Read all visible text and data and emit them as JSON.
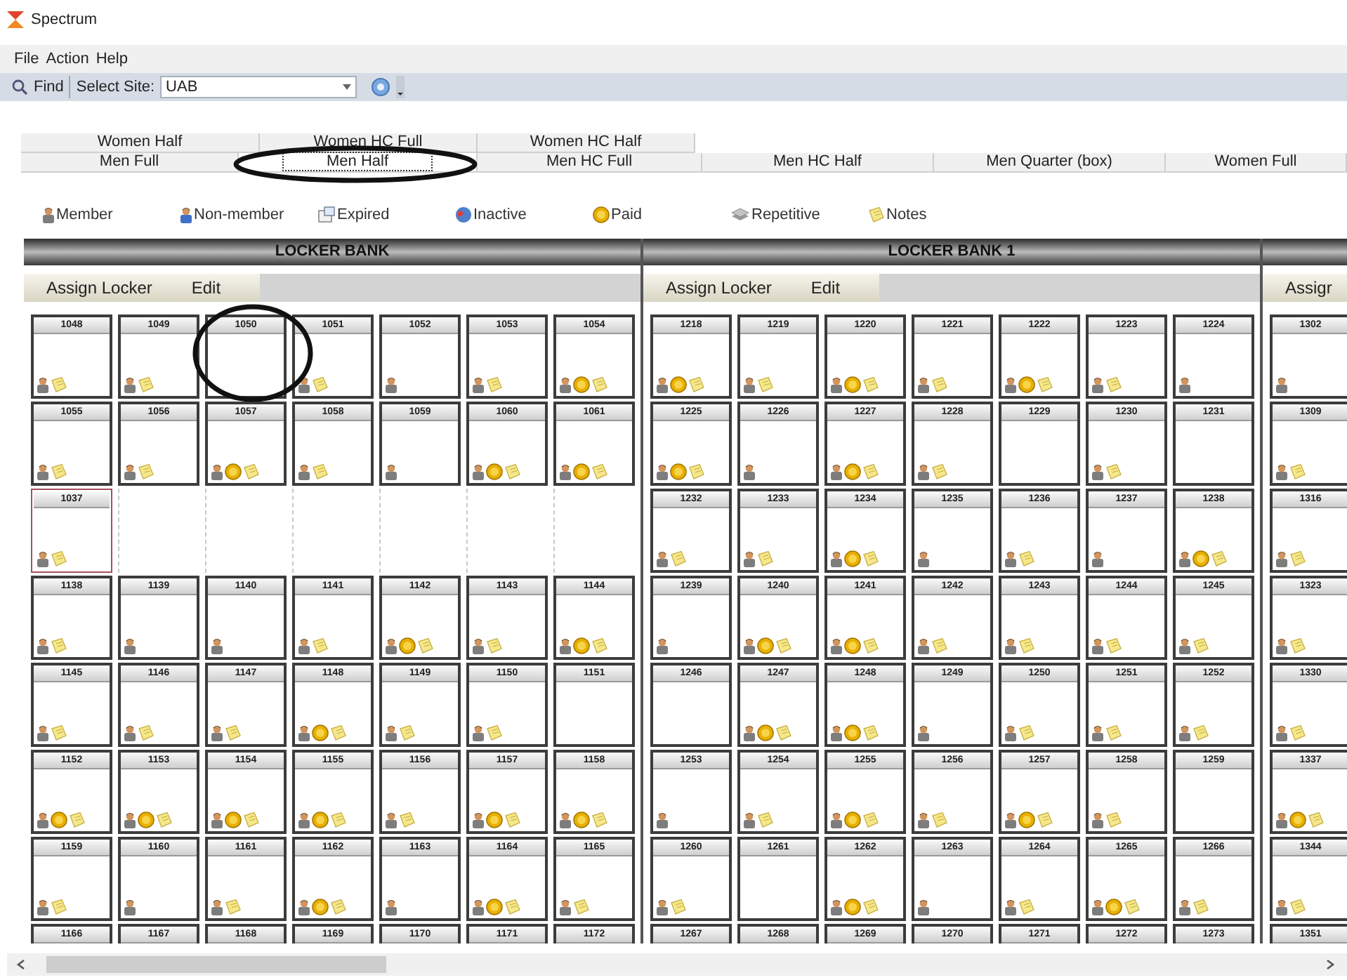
{
  "window": {
    "title": "Spectrum"
  },
  "menu": [
    "File",
    "Action",
    "Help"
  ],
  "toolbar": {
    "find_label": "Find",
    "site_label": "Select Site:",
    "site_value": "UAB"
  },
  "tab_rows": [
    [
      {
        "label": "Women Half",
        "selected": false
      },
      {
        "label": "Women HC Full",
        "selected": false
      },
      {
        "label": "Women HC Half",
        "selected": false
      }
    ],
    [
      {
        "label": "Men Full",
        "selected": false
      },
      {
        "label": "Men Half",
        "selected": true
      },
      {
        "label": "Men HC Full",
        "selected": false
      },
      {
        "label": "Men HC Half",
        "selected": false
      },
      {
        "label": "Men Quarter (box)",
        "selected": false
      },
      {
        "label": "Women Full",
        "selected": false
      }
    ]
  ],
  "legend": [
    {
      "kind": "member",
      "label": "Member"
    },
    {
      "kind": "non-member",
      "label": "Non-member"
    },
    {
      "kind": "expired",
      "label": "Expired"
    },
    {
      "kind": "inactive",
      "label": "Inactive"
    },
    {
      "kind": "paid",
      "label": "Paid"
    },
    {
      "kind": "repetitive",
      "label": "Repetitive"
    },
    {
      "kind": "notes",
      "label": "Notes"
    }
  ],
  "banks": [
    {
      "title": "LOCKER BANK",
      "assign_label": "Assign Locker",
      "edit_label": "Edit",
      "rows": [
        [
          {
            "number": "1048",
            "member": true,
            "paid": false,
            "notes": true,
            "selected": false
          },
          {
            "number": "1049",
            "member": true,
            "paid": false,
            "notes": true,
            "selected": false
          },
          {
            "number": "1050",
            "member": false,
            "paid": false,
            "notes": false,
            "selected": false
          },
          {
            "number": "1051",
            "member": true,
            "paid": false,
            "notes": true,
            "selected": false
          },
          {
            "number": "1052",
            "member": true,
            "paid": false,
            "notes": false,
            "selected": false
          },
          {
            "number": "1053",
            "member": true,
            "paid": false,
            "notes": true,
            "selected": false
          },
          {
            "number": "1054",
            "member": true,
            "paid": true,
            "notes": true,
            "selected": false
          }
        ],
        [
          {
            "number": "1055",
            "member": true,
            "paid": false,
            "notes": true,
            "selected": false
          },
          {
            "number": "1056",
            "member": true,
            "paid": false,
            "notes": true,
            "selected": false
          },
          {
            "number": "1057",
            "member": true,
            "paid": true,
            "notes": true,
            "selected": false
          },
          {
            "number": "1058",
            "member": true,
            "paid": false,
            "notes": true,
            "selected": false
          },
          {
            "number": "1059",
            "member": true,
            "paid": false,
            "notes": false,
            "selected": false
          },
          {
            "number": "1060",
            "member": true,
            "paid": true,
            "notes": true,
            "selected": false
          },
          {
            "number": "1061",
            "member": true,
            "paid": true,
            "notes": true,
            "selected": false
          }
        ],
        [
          {
            "number": "1037",
            "member": true,
            "paid": false,
            "notes": true,
            "selected": true
          }
        ],
        [
          {
            "number": "1138",
            "member": true,
            "paid": false,
            "notes": true,
            "selected": false
          },
          {
            "number": "1139",
            "member": true,
            "paid": false,
            "notes": false,
            "selected": false
          },
          {
            "number": "1140",
            "member": true,
            "paid": false,
            "notes": false,
            "selected": false
          },
          {
            "number": "1141",
            "member": true,
            "paid": false,
            "notes": true,
            "selected": false
          },
          {
            "number": "1142",
            "member": true,
            "paid": true,
            "notes": true,
            "selected": false
          },
          {
            "number": "1143",
            "member": true,
            "paid": false,
            "notes": true,
            "selected": false
          },
          {
            "number": "1144",
            "member": true,
            "paid": true,
            "notes": true,
            "selected": false
          }
        ],
        [
          {
            "number": "1145",
            "member": true,
            "paid": false,
            "notes": true,
            "selected": false
          },
          {
            "number": "1146",
            "member": true,
            "paid": false,
            "notes": true,
            "selected": false
          },
          {
            "number": "1147",
            "member": true,
            "paid": false,
            "notes": true,
            "selected": false
          },
          {
            "number": "1148",
            "member": true,
            "paid": true,
            "notes": true,
            "selected": false
          },
          {
            "number": "1149",
            "member": true,
            "paid": false,
            "notes": true,
            "selected": false
          },
          {
            "number": "1150",
            "member": true,
            "paid": false,
            "notes": true,
            "selected": false
          },
          {
            "number": "1151",
            "member": false,
            "paid": false,
            "notes": false,
            "selected": false
          }
        ],
        [
          {
            "number": "1152",
            "member": true,
            "paid": true,
            "notes": true,
            "selected": false
          },
          {
            "number": "1153",
            "member": true,
            "paid": true,
            "notes": true,
            "selected": false
          },
          {
            "number": "1154",
            "member": true,
            "paid": true,
            "notes": true,
            "selected": false
          },
          {
            "number": "1155",
            "member": true,
            "paid": true,
            "notes": true,
            "selected": false
          },
          {
            "number": "1156",
            "member": true,
            "paid": false,
            "notes": true,
            "selected": false
          },
          {
            "number": "1157",
            "member": true,
            "paid": true,
            "notes": true,
            "selected": false
          },
          {
            "number": "1158",
            "member": true,
            "paid": true,
            "notes": true,
            "selected": false
          }
        ],
        [
          {
            "number": "1159",
            "member": true,
            "paid": false,
            "notes": true,
            "selected": false
          },
          {
            "number": "1160",
            "member": true,
            "paid": false,
            "notes": false,
            "selected": false
          },
          {
            "number": "1161",
            "member": true,
            "paid": false,
            "notes": true,
            "selected": false
          },
          {
            "number": "1162",
            "member": true,
            "paid": true,
            "notes": true,
            "selected": false
          },
          {
            "number": "1163",
            "member": true,
            "paid": false,
            "notes": false,
            "selected": false
          },
          {
            "number": "1164",
            "member": true,
            "paid": true,
            "notes": true,
            "selected": false
          },
          {
            "number": "1165",
            "member": true,
            "paid": false,
            "notes": true,
            "selected": false
          }
        ],
        [
          {
            "number": "1166",
            "selected": false
          },
          {
            "number": "1167",
            "selected": false
          },
          {
            "number": "1168",
            "selected": false
          },
          {
            "number": "1169",
            "selected": false
          },
          {
            "number": "1170",
            "selected": false
          },
          {
            "number": "1171",
            "selected": false
          },
          {
            "number": "1172",
            "selected": false
          }
        ]
      ]
    },
    {
      "title": "LOCKER BANK 1",
      "assign_label": "Assign Locker",
      "edit_label": "Edit",
      "rows": [
        [
          {
            "number": "1218",
            "member": true,
            "paid": true,
            "notes": true,
            "selected": false
          },
          {
            "number": "1219",
            "member": true,
            "paid": false,
            "notes": true,
            "selected": false
          },
          {
            "number": "1220",
            "member": true,
            "paid": true,
            "notes": true,
            "selected": false
          },
          {
            "number": "1221",
            "member": true,
            "paid": false,
            "notes": true,
            "selected": false
          },
          {
            "number": "1222",
            "member": true,
            "paid": true,
            "notes": true,
            "selected": false
          },
          {
            "number": "1223",
            "member": true,
            "paid": false,
            "notes": true,
            "selected": false
          },
          {
            "number": "1224",
            "member": true,
            "paid": false,
            "notes": false,
            "selected": false
          }
        ],
        [
          {
            "number": "1225",
            "member": true,
            "paid": true,
            "notes": true,
            "selected": false
          },
          {
            "number": "1226",
            "member": true,
            "paid": false,
            "notes": false,
            "selected": false
          },
          {
            "number": "1227",
            "member": true,
            "paid": true,
            "notes": true,
            "selected": false
          },
          {
            "number": "1228",
            "member": true,
            "paid": false,
            "notes": true,
            "selected": false
          },
          {
            "number": "1229",
            "member": false,
            "paid": false,
            "notes": false,
            "selected": false
          },
          {
            "number": "1230",
            "member": true,
            "paid": false,
            "notes": true,
            "selected": false
          },
          {
            "number": "1231",
            "member": false,
            "paid": false,
            "notes": false,
            "selected": false
          }
        ],
        [
          {
            "number": "1232",
            "member": true,
            "paid": false,
            "notes": true,
            "selected": false
          },
          {
            "number": "1233",
            "member": true,
            "paid": false,
            "notes": true,
            "selected": false
          },
          {
            "number": "1234",
            "member": true,
            "paid": true,
            "notes": true,
            "selected": false
          },
          {
            "number": "1235",
            "member": true,
            "paid": false,
            "notes": false,
            "selected": false
          },
          {
            "number": "1236",
            "member": true,
            "paid": false,
            "notes": true,
            "selected": false
          },
          {
            "number": "1237",
            "member": true,
            "paid": false,
            "notes": false,
            "selected": false
          },
          {
            "number": "1238",
            "member": true,
            "paid": true,
            "notes": true,
            "selected": false
          }
        ],
        [
          {
            "number": "1239",
            "member": true,
            "paid": false,
            "notes": false,
            "selected": false
          },
          {
            "number": "1240",
            "member": true,
            "paid": true,
            "notes": true,
            "selected": false
          },
          {
            "number": "1241",
            "member": true,
            "paid": true,
            "notes": true,
            "selected": false
          },
          {
            "number": "1242",
            "member": true,
            "paid": false,
            "notes": true,
            "selected": false
          },
          {
            "number": "1243",
            "member": true,
            "paid": false,
            "notes": true,
            "selected": false
          },
          {
            "number": "1244",
            "member": true,
            "paid": false,
            "notes": true,
            "selected": false
          },
          {
            "number": "1245",
            "member": true,
            "paid": false,
            "notes": true,
            "selected": false
          }
        ],
        [
          {
            "number": "1246",
            "member": false,
            "paid": false,
            "notes": false,
            "selected": false
          },
          {
            "number": "1247",
            "member": true,
            "paid": true,
            "notes": true,
            "selected": false
          },
          {
            "number": "1248",
            "member": true,
            "paid": true,
            "notes": true,
            "selected": false
          },
          {
            "number": "1249",
            "member": true,
            "paid": false,
            "notes": false,
            "selected": false
          },
          {
            "number": "1250",
            "member": true,
            "paid": false,
            "notes": true,
            "selected": false
          },
          {
            "number": "1251",
            "member": true,
            "paid": false,
            "notes": true,
            "selected": false
          },
          {
            "number": "1252",
            "member": true,
            "paid": false,
            "notes": true,
            "selected": false
          }
        ],
        [
          {
            "number": "1253",
            "member": true,
            "paid": false,
            "notes": false,
            "selected": false
          },
          {
            "number": "1254",
            "member": true,
            "paid": false,
            "notes": true,
            "selected": false
          },
          {
            "number": "1255",
            "member": true,
            "paid": true,
            "notes": true,
            "selected": false
          },
          {
            "number": "1256",
            "member": true,
            "paid": false,
            "notes": true,
            "selected": false
          },
          {
            "number": "1257",
            "member": true,
            "paid": true,
            "notes": true,
            "selected": false
          },
          {
            "number": "1258",
            "member": true,
            "paid": false,
            "notes": true,
            "selected": false
          },
          {
            "number": "1259",
            "member": false,
            "paid": false,
            "notes": false,
            "selected": false
          }
        ],
        [
          {
            "number": "1260",
            "member": true,
            "paid": false,
            "notes": true,
            "selected": false
          },
          {
            "number": "1261",
            "member": false,
            "paid": false,
            "notes": false,
            "selected": false
          },
          {
            "number": "1262",
            "member": true,
            "paid": true,
            "notes": true,
            "selected": false
          },
          {
            "number": "1263",
            "member": true,
            "paid": false,
            "notes": false,
            "selected": false
          },
          {
            "number": "1264",
            "member": true,
            "paid": false,
            "notes": true,
            "selected": false
          },
          {
            "number": "1265",
            "member": true,
            "paid": true,
            "notes": true,
            "selected": false
          },
          {
            "number": "1266",
            "member": true,
            "paid": false,
            "notes": true,
            "selected": false
          }
        ],
        [
          {
            "number": "1267",
            "selected": false
          },
          {
            "number": "1268",
            "selected": false
          },
          {
            "number": "1269",
            "selected": false
          },
          {
            "number": "1270",
            "selected": false
          },
          {
            "number": "1271",
            "selected": false
          },
          {
            "number": "1272",
            "selected": false
          },
          {
            "number": "1273",
            "selected": false
          }
        ]
      ]
    },
    {
      "assign_label": "Assigr",
      "rows": [
        [
          {
            "number": "1302",
            "member": true,
            "paid": false,
            "notes": false,
            "selected": false
          }
        ],
        [
          {
            "number": "1309",
            "member": true,
            "paid": false,
            "notes": true,
            "selected": false
          }
        ],
        [
          {
            "number": "1316",
            "member": true,
            "paid": false,
            "notes": true,
            "selected": false
          }
        ],
        [
          {
            "number": "1323",
            "member": true,
            "paid": false,
            "notes": true,
            "selected": false
          }
        ],
        [
          {
            "number": "1330",
            "member": true,
            "paid": false,
            "notes": true,
            "selected": false
          }
        ],
        [
          {
            "number": "1337",
            "member": true,
            "paid": true,
            "notes": true,
            "selected": false
          }
        ],
        [
          {
            "number": "1344",
            "member": true,
            "paid": false,
            "notes": true,
            "selected": false
          }
        ],
        [
          {
            "number": "1351",
            "selected": false
          }
        ]
      ]
    }
  ]
}
